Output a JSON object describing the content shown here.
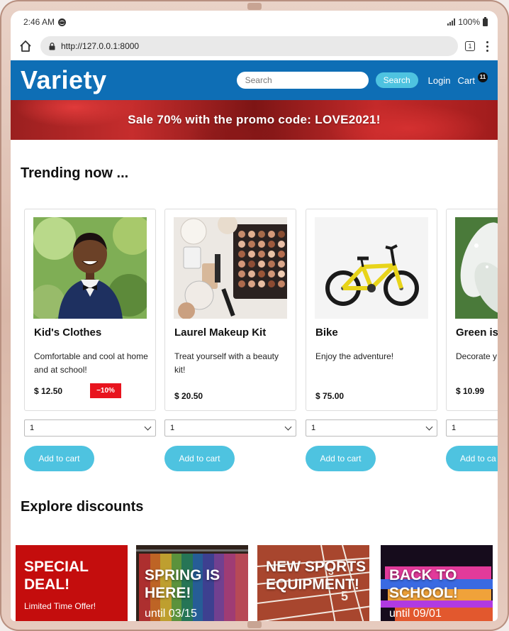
{
  "status": {
    "time": "2:46 AM",
    "battery": "100%"
  },
  "browser": {
    "url": "http://127.0.0.1:8000",
    "tab_count": "1"
  },
  "navbar": {
    "brand": "Variety",
    "search_placeholder": "Search",
    "search_button": "Search",
    "login": "Login",
    "cart": "Cart",
    "cart_count": "11"
  },
  "banner": {
    "text": "Sale 70% with the promo code: LOVE2021!"
  },
  "trending": {
    "title": "Trending now ...",
    "products": [
      {
        "name": "Kid's Clothes",
        "description": "Comfortable and cool at home and at school!",
        "price": "$ 12.50",
        "discount": "−10%",
        "qty": "1",
        "button": "Add to cart"
      },
      {
        "name": "Laurel Makeup Kit",
        "description": "Treat yourself with a beauty kit!",
        "price": "$ 20.50",
        "qty": "1",
        "button": "Add to cart"
      },
      {
        "name": "Bike",
        "description": "Enjoy the adventure!",
        "price": "$ 75.00",
        "qty": "1",
        "button": "Add to cart"
      },
      {
        "name": "Green is",
        "description": "Decorate y with plants",
        "price": "$ 10.99",
        "qty": "1",
        "button": "Add to ca"
      }
    ]
  },
  "discounts": {
    "title": "Explore discounts",
    "items": [
      {
        "title": "SPECIAL DEAL!",
        "subtitle": "Limited Time Offer!",
        "color": "#c40d0d"
      },
      {
        "title": "SPRING IS HERE!",
        "subtitle": "until 03/15"
      },
      {
        "title": "NEW SPORTS EQUIPMENT!"
      },
      {
        "title": "BACK TO SCHOOL!",
        "subtitle": "until 09/01"
      }
    ]
  },
  "colors": {
    "navbar": "#0e6eb5",
    "accent": "#4ec3e0",
    "discount_badge": "#e8141e"
  }
}
